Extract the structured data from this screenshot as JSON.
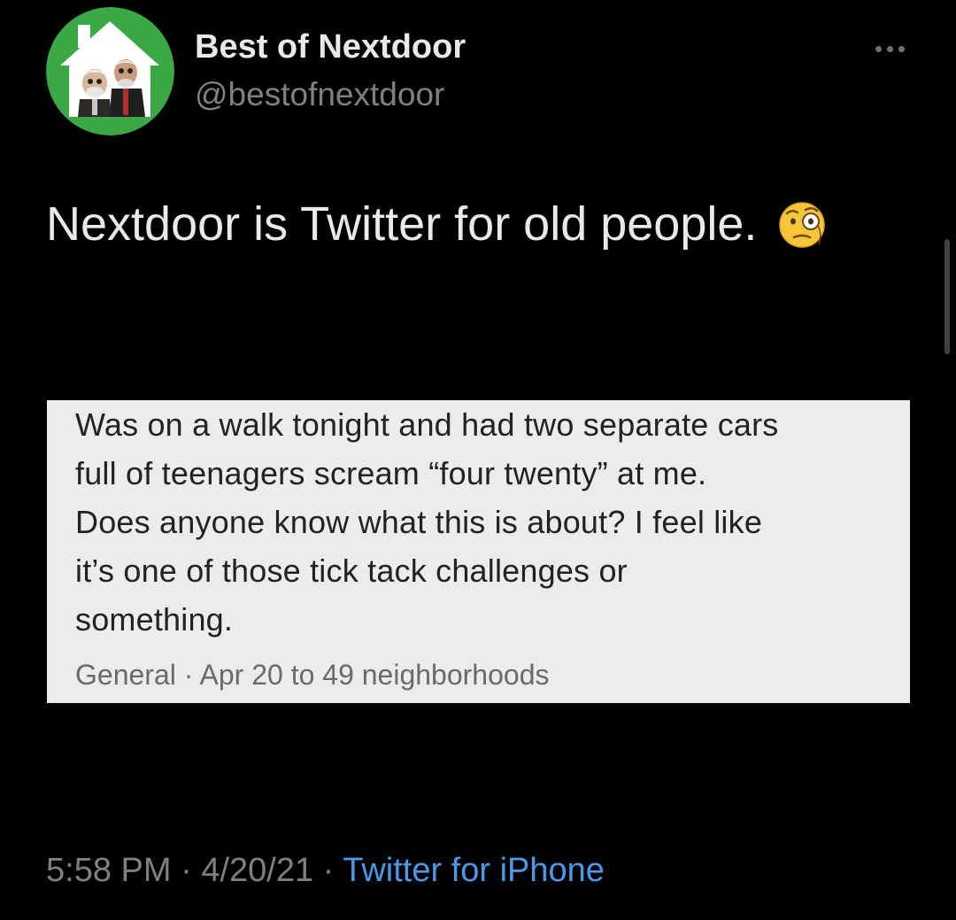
{
  "author": {
    "display_name": "Best of Nextdoor",
    "handle": "@bestofnextdoor",
    "avatar_icon": "house-logo-with-muppets-icon"
  },
  "more_icon": "more-dots-icon",
  "tweet": {
    "text": "Nextdoor is Twitter for old people.",
    "emoji_icon": "face-with-monocle-icon"
  },
  "embedded_post": {
    "lines": [
      "Was on a walk tonight and had two separate cars",
      "full of teenagers scream “four twenty” at me.",
      "Does anyone know what this is about? I feel like",
      "it’s one of those tick tack challenges or",
      "something."
    ],
    "meta": "General · Apr 20 to 49 neighborhoods"
  },
  "footer": {
    "time": "5:58 PM",
    "date": "4/20/21",
    "separator": "·",
    "source": "Twitter for iPhone"
  },
  "colors": {
    "background": "#000000",
    "text": "#e7e9ea",
    "secondary": "#7d8184",
    "link": "#4a99e9",
    "avatar_green": "#3aa845",
    "card_bg": "#ececed"
  }
}
